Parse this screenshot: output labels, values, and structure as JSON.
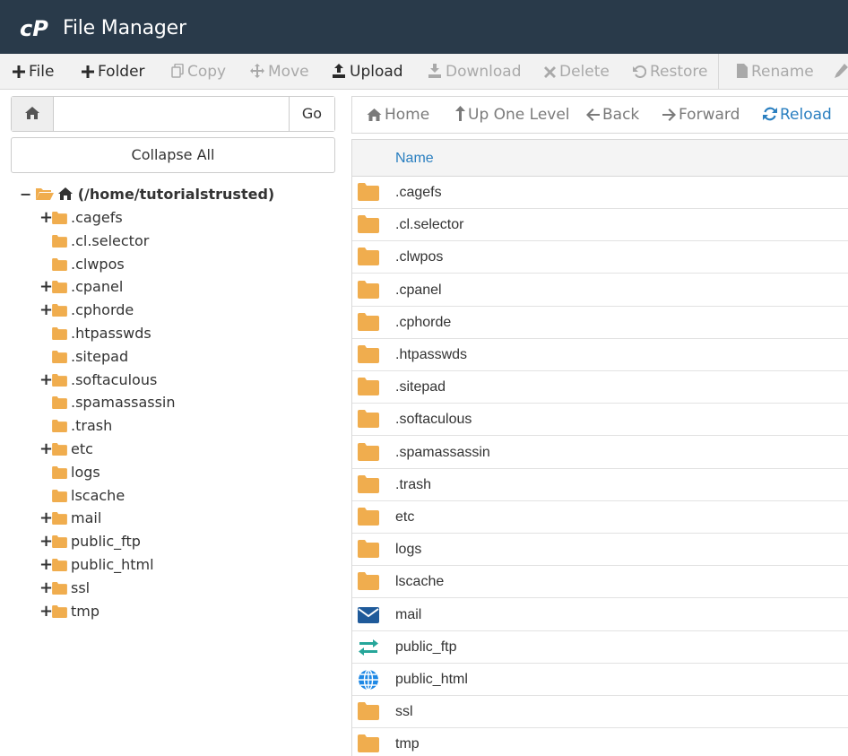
{
  "header": {
    "title": "File Manager",
    "logo_icon": "cpanel-logo-icon"
  },
  "toolbar": {
    "items": [
      {
        "label": "File",
        "icon": "plus-icon",
        "enabled": true
      },
      {
        "label": "Folder",
        "icon": "plus-icon",
        "enabled": true
      },
      {
        "label": "Copy",
        "icon": "copy-icon",
        "enabled": false
      },
      {
        "label": "Move",
        "icon": "move-icon",
        "enabled": false
      },
      {
        "label": "Upload",
        "icon": "upload-icon",
        "enabled": true
      },
      {
        "label": "Download",
        "icon": "download-icon",
        "enabled": false
      },
      {
        "label": "Delete",
        "icon": "times-icon",
        "enabled": false
      },
      {
        "label": "Restore",
        "icon": "undo-icon",
        "enabled": false
      },
      {
        "label": "Rename",
        "icon": "file-icon",
        "enabled": false
      },
      {
        "label": "",
        "icon": "pencil-icon",
        "enabled": false
      }
    ]
  },
  "search": {
    "value": "",
    "placeholder": "",
    "go_label": "Go",
    "home_icon": "home-icon"
  },
  "collapse_label": "Collapse All",
  "tree": {
    "root": {
      "label": "(/home/tutorialstrusted)",
      "toggle": "−",
      "folder_icon": "folder-open-icon",
      "home_icon": "home-icon"
    },
    "items": [
      {
        "label": ".cagefs",
        "expandable": true
      },
      {
        "label": ".cl.selector",
        "expandable": false
      },
      {
        "label": ".clwpos",
        "expandable": false
      },
      {
        "label": ".cpanel",
        "expandable": true
      },
      {
        "label": ".cphorde",
        "expandable": true
      },
      {
        "label": ".htpasswds",
        "expandable": false
      },
      {
        "label": ".sitepad",
        "expandable": false
      },
      {
        "label": ".softaculous",
        "expandable": true
      },
      {
        "label": ".spamassassin",
        "expandable": false
      },
      {
        "label": ".trash",
        "expandable": false
      },
      {
        "label": "etc",
        "expandable": true
      },
      {
        "label": "logs",
        "expandable": false
      },
      {
        "label": "lscache",
        "expandable": false
      },
      {
        "label": "mail",
        "expandable": true
      },
      {
        "label": "public_ftp",
        "expandable": true
      },
      {
        "label": "public_html",
        "expandable": true
      },
      {
        "label": "ssl",
        "expandable": true
      },
      {
        "label": "tmp",
        "expandable": true
      }
    ],
    "plus_sign": "+"
  },
  "nav": {
    "items": [
      {
        "label": "Home",
        "icon": "home-icon",
        "active": false
      },
      {
        "label": "Up One Level",
        "icon": "level-up-icon",
        "active": false
      },
      {
        "label": "Back",
        "icon": "arrow-left-icon",
        "active": false
      },
      {
        "label": "Forward",
        "icon": "arrow-right-icon",
        "active": false
      },
      {
        "label": "Reload",
        "icon": "refresh-icon",
        "active": true
      }
    ]
  },
  "filelist": {
    "column_name": "Name",
    "rows": [
      {
        "name": ".cagefs",
        "icon": "folder-icon"
      },
      {
        "name": ".cl.selector",
        "icon": "folder-icon"
      },
      {
        "name": ".clwpos",
        "icon": "folder-icon"
      },
      {
        "name": ".cpanel",
        "icon": "folder-icon"
      },
      {
        "name": ".cphorde",
        "icon": "folder-icon"
      },
      {
        "name": ".htpasswds",
        "icon": "folder-icon"
      },
      {
        "name": ".sitepad",
        "icon": "folder-icon"
      },
      {
        "name": ".softaculous",
        "icon": "folder-icon"
      },
      {
        "name": ".spamassassin",
        "icon": "folder-icon"
      },
      {
        "name": ".trash",
        "icon": "folder-icon"
      },
      {
        "name": "etc",
        "icon": "folder-icon"
      },
      {
        "name": "logs",
        "icon": "folder-icon"
      },
      {
        "name": "lscache",
        "icon": "folder-icon"
      },
      {
        "name": "mail",
        "icon": "mail-icon"
      },
      {
        "name": "public_ftp",
        "icon": "transfer-icon"
      },
      {
        "name": "public_html",
        "icon": "globe-icon"
      },
      {
        "name": "ssl",
        "icon": "folder-icon"
      },
      {
        "name": "tmp",
        "icon": "folder-icon"
      }
    ]
  },
  "colors": {
    "header_bg": "#293a4a",
    "folder": "#f0ad4e",
    "link_blue": "#2a7fc0",
    "mail_blue": "#1f5a9a",
    "ftp_green": "#26a69a",
    "globe_blue": "#1e88e5"
  }
}
